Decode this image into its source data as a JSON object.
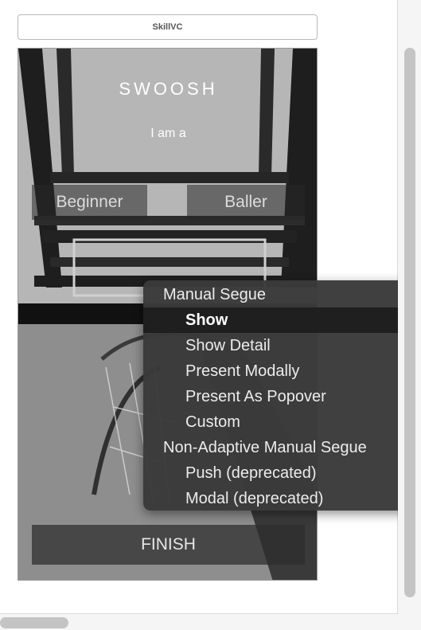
{
  "scene": {
    "title": "SkillVC"
  },
  "screen": {
    "logo": "SWOOSH",
    "subtitle": "I am a",
    "beginner_label": "Beginner",
    "baller_label": "Baller",
    "finish_label": "FINISH"
  },
  "segue_menu": {
    "items": [
      {
        "label": "Manual Segue",
        "kind": "header"
      },
      {
        "label": "Show",
        "kind": "option",
        "selected": true
      },
      {
        "label": "Show Detail",
        "kind": "option"
      },
      {
        "label": "Present Modally",
        "kind": "option"
      },
      {
        "label": "Present As Popover",
        "kind": "option"
      },
      {
        "label": "Custom",
        "kind": "option"
      },
      {
        "label": "Non-Adaptive Manual Segue",
        "kind": "header"
      },
      {
        "label": "Push (deprecated)",
        "kind": "option"
      },
      {
        "label": "Modal (deprecated)",
        "kind": "option"
      }
    ]
  }
}
